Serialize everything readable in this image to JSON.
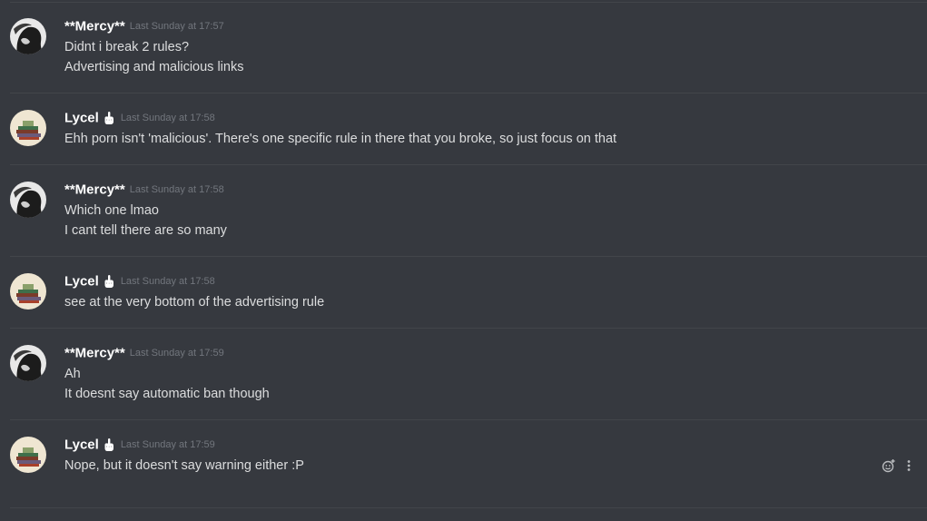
{
  "colors": {
    "background": "#36393f",
    "username": "#ffffff",
    "timestamp": "#72767d",
    "message_text": "#dcddde",
    "divider": "#42454a"
  },
  "messages": [
    {
      "author": "**Mercy**",
      "avatar": "mercy-avatar",
      "timestamp": "Last Sunday at 17:57",
      "lines": [
        "Didnt i break 2 rules?",
        "Advertising and malicious links"
      ]
    },
    {
      "author": "Lycel",
      "avatar": "lycel-avatar",
      "badge_icon": "middle-finger-icon",
      "timestamp": "Last Sunday at 17:58",
      "lines": [
        "Ehh porn isn't 'malicious'. There's one specific rule in there that you broke, so just focus on that"
      ]
    },
    {
      "author": "**Mercy**",
      "avatar": "mercy-avatar",
      "timestamp": "Last Sunday at 17:58",
      "lines": [
        "Which one lmao",
        "I cant tell there are so many"
      ]
    },
    {
      "author": "Lycel",
      "avatar": "lycel-avatar",
      "badge_icon": "middle-finger-icon",
      "timestamp": "Last Sunday at 17:58",
      "lines": [
        "see at the very bottom of the advertising rule"
      ]
    },
    {
      "author": "**Mercy**",
      "avatar": "mercy-avatar",
      "timestamp": "Last Sunday at 17:59",
      "lines": [
        "Ah",
        "It doesnt say automatic ban though"
      ]
    },
    {
      "author": "Lycel",
      "avatar": "lycel-avatar",
      "badge_icon": "middle-finger-icon",
      "timestamp": "Last Sunday at 17:59",
      "lines": [
        "Nope, but it doesn't say warning either :P"
      ]
    }
  ],
  "hover_actions": [
    "add-reaction-icon",
    "more-options-icon"
  ]
}
